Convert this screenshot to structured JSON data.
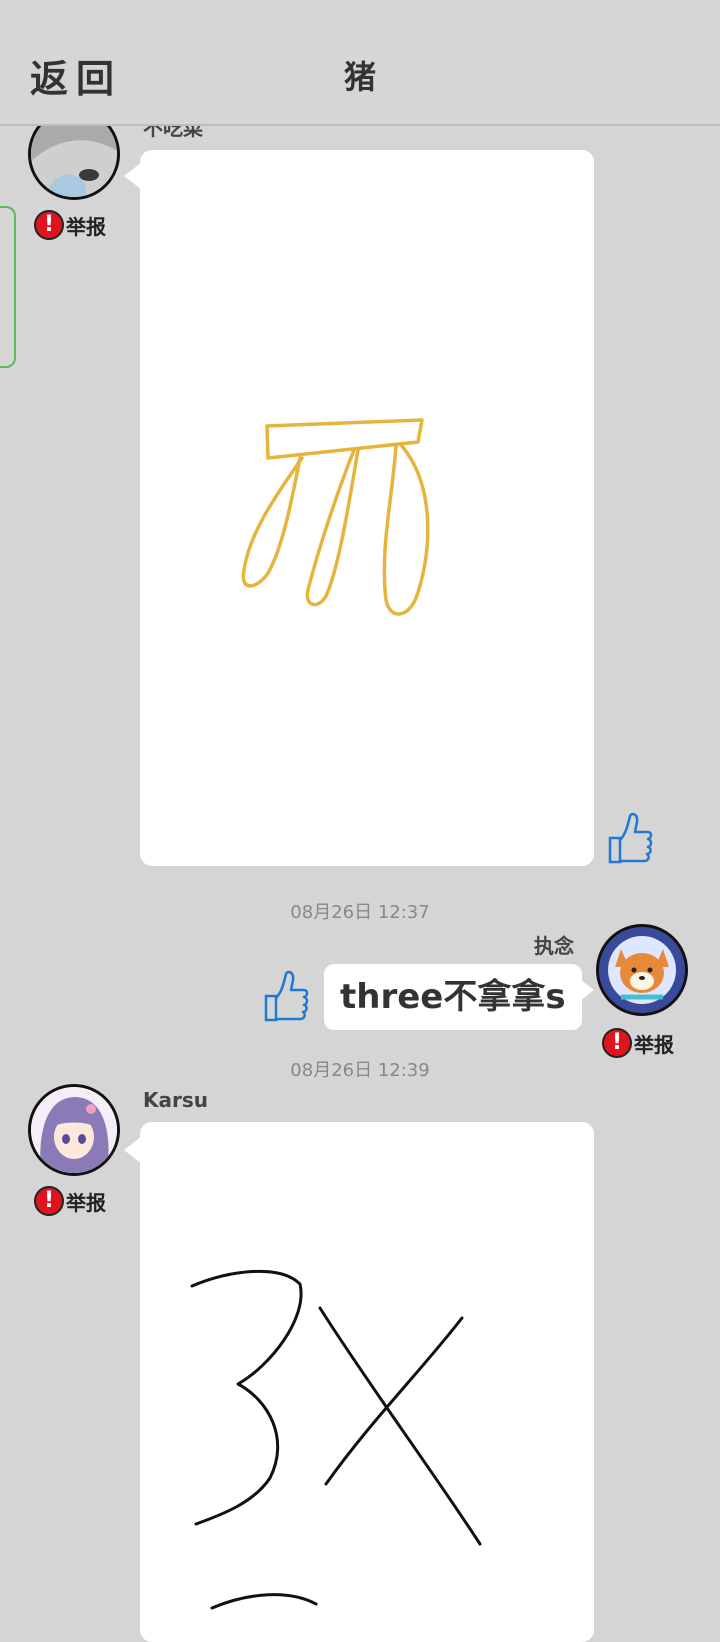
{
  "header": {
    "back_label": "返回",
    "title": "猪"
  },
  "messages": [
    {
      "username": "不吃菜",
      "report_label": "举报",
      "type": "drawing",
      "drawing": "yellow-claw-sketch",
      "stroke_color": "#e6b43c"
    },
    {
      "timestamp": "08月26日  12:37",
      "username": "执念",
      "report_label": "举报",
      "type": "text",
      "text": "three不拿拿s"
    },
    {
      "timestamp": "08月26日  12:39",
      "username": "Karsu",
      "report_label": "举报",
      "type": "drawing",
      "drawing": "black-3x-sketch",
      "stroke_color": "#111111"
    }
  ],
  "colors": {
    "background": "#d5d5d5",
    "report_badge": "#e0141e",
    "like_icon": "#1f78d1"
  },
  "icons": {
    "report": "exclamation-badge-icon",
    "like": "thumbs-up-icon"
  }
}
